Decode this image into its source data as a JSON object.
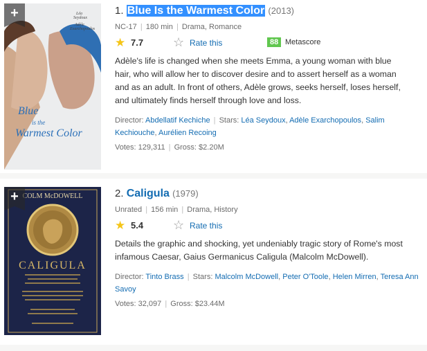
{
  "colors": {
    "link": "#136cb2",
    "metascore_bg": "#61c74f",
    "star": "#f5c518",
    "selection": "#3390ff"
  },
  "items": [
    {
      "index": "1.",
      "title": "Blue Is the Warmest Color",
      "year": "(2013)",
      "certificate": "NC-17",
      "runtime": "180 min",
      "genre": "Drama, Romance",
      "rating": "7.7",
      "rate_label": "Rate this",
      "metascore": "88",
      "metascore_label": "Metascore",
      "plot": "Adèle's life is changed when she meets Emma, a young woman with blue hair, who will allow her to discover desire and to assert herself as a woman and as an adult. In front of others, Adèle grows, seeks herself, loses herself, and ultimately finds herself through love and loss.",
      "director_label": "Director:",
      "directors": [
        "Abdellatif Kechiche"
      ],
      "stars_label": "Stars:",
      "stars": [
        "Léa Seydoux",
        "Adèle Exarchopoulos",
        "Salim Kechiouche",
        "Aurélien Recoing"
      ],
      "votes_label": "Votes:",
      "votes": "129,311",
      "gross_label": "Gross:",
      "gross": "$2.20M",
      "poster": {
        "top_names": "Léa Seydoux  Adèle Exarchopoulos",
        "title_art": "Blue is the Warmest Color"
      }
    },
    {
      "index": "2.",
      "title": "Caligula",
      "year": "(1979)",
      "certificate": "Unrated",
      "runtime": "156 min",
      "genre": "Drama, History",
      "rating": "5.4",
      "rate_label": "Rate this",
      "plot": "Details the graphic and shocking, yet undeniably tragic story of Rome's most infamous Caesar, Gaius Germanicus Caligula (Malcolm McDowell).",
      "director_label": "Director:",
      "directors": [
        "Tinto Brass"
      ],
      "stars_label": "Stars:",
      "stars": [
        "Malcolm McDowell",
        "Peter O'Toole",
        "Helen Mirren",
        "Teresa Ann Savoy"
      ],
      "votes_label": "Votes:",
      "votes": "32,097",
      "gross_label": "Gross:",
      "gross": "$23.44M",
      "poster": {
        "top_names": "COLM McDOWELL",
        "title_art": "CALIGULA"
      }
    }
  ]
}
